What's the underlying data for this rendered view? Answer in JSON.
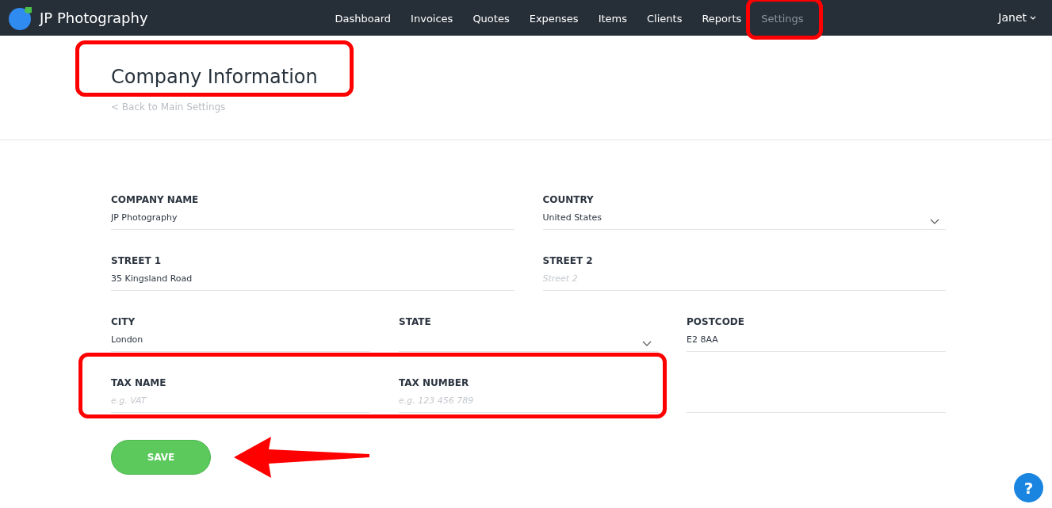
{
  "navbar": {
    "brand": "JP Photography",
    "nav_items": [
      {
        "label": "Dashboard",
        "selected": false,
        "highlighted": false
      },
      {
        "label": "Invoices",
        "selected": false,
        "highlighted": false
      },
      {
        "label": "Quotes",
        "selected": false,
        "highlighted": false
      },
      {
        "label": "Expenses",
        "selected": false,
        "highlighted": false
      },
      {
        "label": "Items",
        "selected": false,
        "highlighted": false
      },
      {
        "label": "Clients",
        "selected": false,
        "highlighted": false
      },
      {
        "label": "Reports",
        "selected": false,
        "highlighted": false
      },
      {
        "label": "Settings",
        "selected": true,
        "highlighted": true
      }
    ],
    "user": "Janet"
  },
  "page": {
    "title": "Company Information",
    "title_highlighted": true,
    "back_link": "< Back to Main Settings"
  },
  "form": {
    "rows": [
      {
        "highlighted": false,
        "fields": [
          {
            "kind": "text",
            "label": "COMPANY NAME",
            "value": "JP Photography"
          },
          {
            "kind": "select",
            "label": "COUNTRY",
            "value": "United States"
          }
        ]
      },
      {
        "highlighted": false,
        "fields": [
          {
            "kind": "text",
            "label": "STREET 1",
            "value": "35 Kingsland Road"
          },
          {
            "kind": "text",
            "label": "STREET 2",
            "placeholder": "Street 2"
          }
        ]
      },
      {
        "highlighted": false,
        "fields": [
          {
            "kind": "text",
            "label": "CITY",
            "value": "London"
          },
          {
            "kind": "select",
            "label": "STATE"
          },
          {
            "kind": "text",
            "label": "POSTCODE",
            "value": "E2 8AA"
          }
        ]
      },
      {
        "highlighted": true,
        "fields": [
          {
            "kind": "text",
            "label": "TAX NAME",
            "placeholder": "e.g. VAT"
          },
          {
            "kind": "text",
            "label": "TAX NUMBER",
            "placeholder": "e.g. 123 456 789"
          },
          {
            "kind": "blank"
          }
        ]
      }
    ]
  },
  "save_button": {
    "label": "SAVE",
    "arrow_pointer": true
  },
  "help_button": {
    "label": "?"
  }
}
